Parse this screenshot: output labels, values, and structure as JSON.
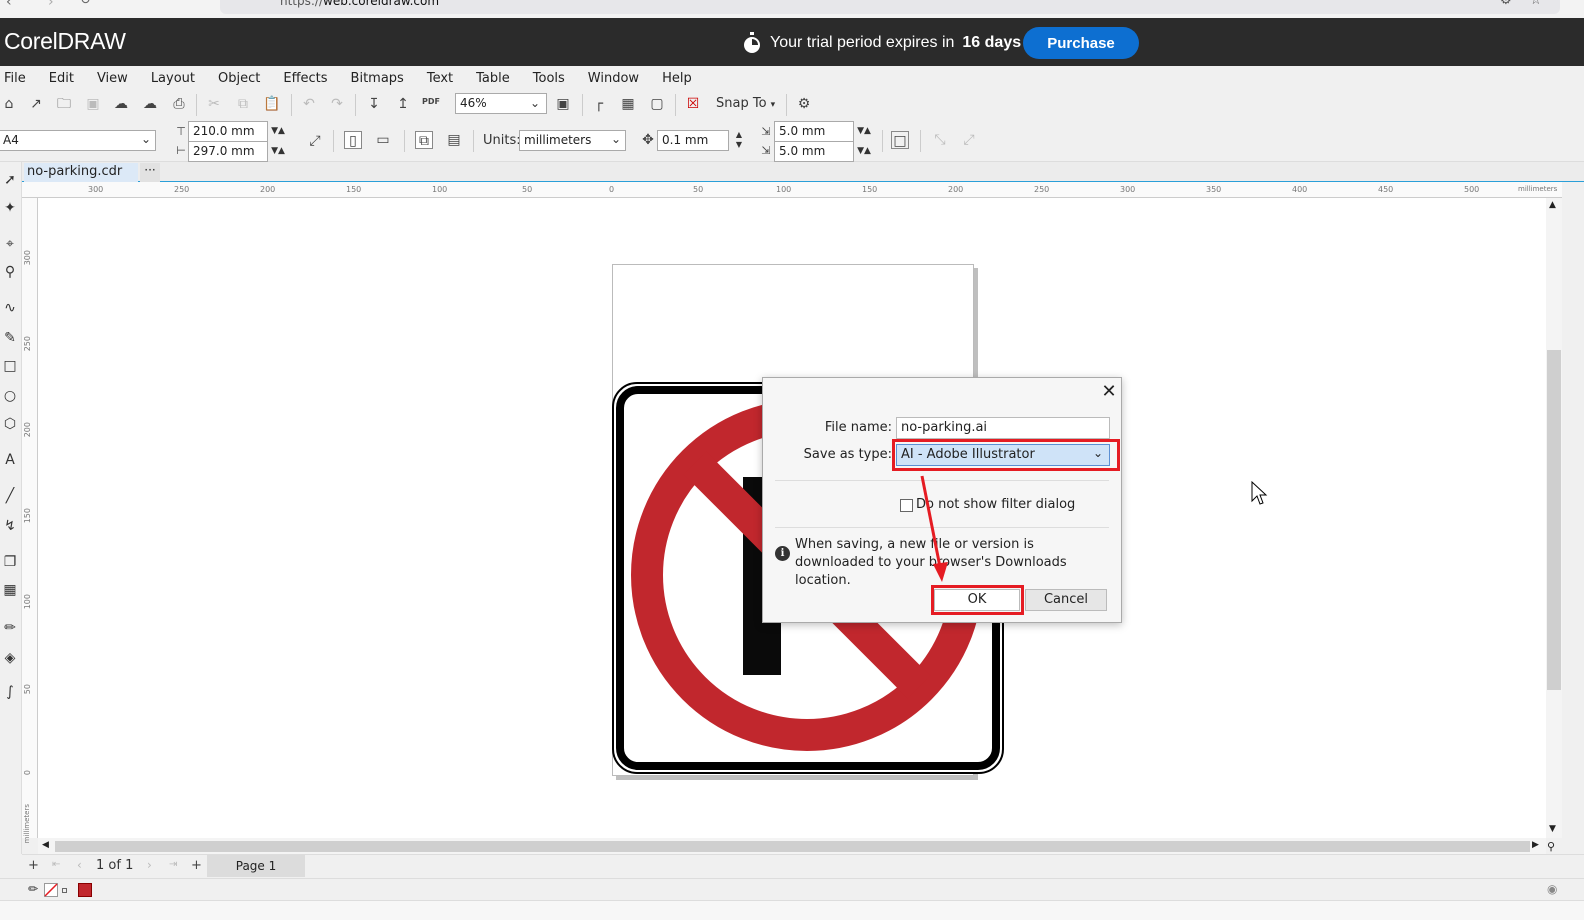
{
  "browser": {
    "url_prefix": "https://",
    "url_domain": "web.coreldraw.com"
  },
  "header": {
    "logo": "CorelDRAW",
    "trial_text": "Your trial period expires in",
    "trial_days": "16 days",
    "purchase_label": "Purchase",
    "brand_color": "#0d6fd1"
  },
  "menubar": {
    "items": [
      "File",
      "Edit",
      "View",
      "Layout",
      "Object",
      "Effects",
      "Bitmaps",
      "Text",
      "Table",
      "Tools",
      "Window",
      "Help"
    ]
  },
  "toolbar1": {
    "zoom": "46%",
    "snap_to_label": "Snap To",
    "pdf_label": "PDF"
  },
  "toolbar2": {
    "page_size": "A4",
    "width": "210.0 mm",
    "height": "297.0 mm",
    "units_label": "Units:",
    "units_value": "millimeters",
    "nudge": "0.1 mm",
    "dup_x": "5.0 mm",
    "dup_y": "5.0 mm"
  },
  "document": {
    "tab_name": "no-parking.cdr",
    "tab_more": "···"
  },
  "rulers": {
    "h_ticks": [
      "300",
      "250",
      "200",
      "150",
      "100",
      "50",
      "0",
      "50",
      "100",
      "150",
      "200",
      "250",
      "300",
      "350",
      "400",
      "450",
      "500"
    ],
    "h_unit": "millimeters",
    "v_ticks": [
      "300",
      "250",
      "200",
      "150",
      "100",
      "50",
      "0"
    ],
    "v_unit": "millimeters"
  },
  "pagebar": {
    "page_count": "1 of 1",
    "page_tab": "Page 1"
  },
  "dialog": {
    "file_name_label": "File name:",
    "file_name_value": "no-parking.ai",
    "save_type_label": "Save as type:",
    "save_type_value": "AI - Adobe Illustrator",
    "checkbox_label": "Do not show filter dialog",
    "checkbox_checked": false,
    "info_text": "When saving, a new file or version is downloaded to your browser's Downloads location.",
    "ok_label": "OK",
    "cancel_label": "Cancel",
    "highlight_color": "#e51c23"
  },
  "sign": {
    "letter": "P",
    "red": "#c1272d"
  }
}
